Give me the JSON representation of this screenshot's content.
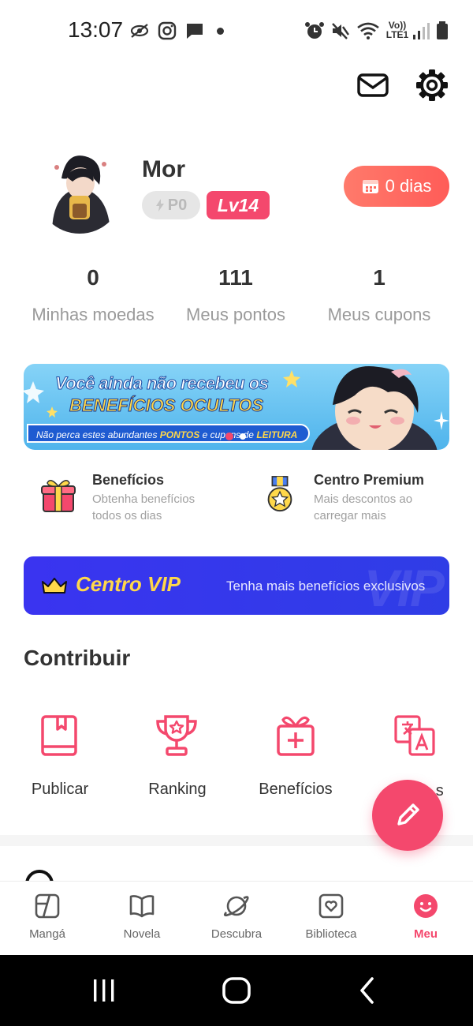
{
  "status_bar": {
    "time": "13:07",
    "network": [
      "Vo))",
      "LTE1"
    ]
  },
  "profile": {
    "username": "Mor",
    "points_badge": "P0",
    "level_badge": "Lv14",
    "streak_button": "0 dias"
  },
  "stats": [
    {
      "value": "0",
      "label": "Minhas moedas"
    },
    {
      "value": "111",
      "label": "Meus pontos"
    },
    {
      "value": "1",
      "label": "Meus cupons"
    }
  ],
  "banner": {
    "line1": "Você ainda não recebeu os",
    "line2": "BENEFÍCIOS OCULTOS",
    "line3_part1": "Não perca estes abundantes ",
    "line3_highlight1": "PONTOS",
    "line3_part2": " e cupons de ",
    "line3_highlight2": "LEITURA"
  },
  "features": [
    {
      "title": "Benefícios",
      "desc": "Obtenha benefícios todos os dias",
      "icon": "gift-icon"
    },
    {
      "title": "Centro Premium",
      "desc": "Mais descontos ao carregar mais",
      "icon": "medal-icon"
    }
  ],
  "vip": {
    "title": "Centro VIP",
    "subtitle": "Tenha mais benefícios exclusivos",
    "watermark": "VIP"
  },
  "contribute": {
    "title": "Contribuir",
    "items": [
      {
        "label": "Publicar",
        "icon": "book-icon"
      },
      {
        "label": "Ranking",
        "icon": "trophy-icon"
      },
      {
        "label": "Benefícios",
        "icon": "gift-plus-icon"
      },
      {
        "label": "...tos ...s",
        "icon": "translate-icon"
      }
    ]
  },
  "bottom_nav": [
    {
      "label": "Mangá",
      "icon": "manga-icon",
      "active": false
    },
    {
      "label": "Novela",
      "icon": "book-open-icon",
      "active": false
    },
    {
      "label": "Descubra",
      "icon": "planet-icon",
      "active": false
    },
    {
      "label": "Biblioteca",
      "icon": "library-icon",
      "active": false
    },
    {
      "label": "Meu",
      "icon": "profile-face-icon",
      "active": true
    }
  ],
  "colors": {
    "accent": "#f4486d",
    "vip_blue": "#3a34f0",
    "streak": "#ff6b5e",
    "muted": "#9a9a9a"
  }
}
